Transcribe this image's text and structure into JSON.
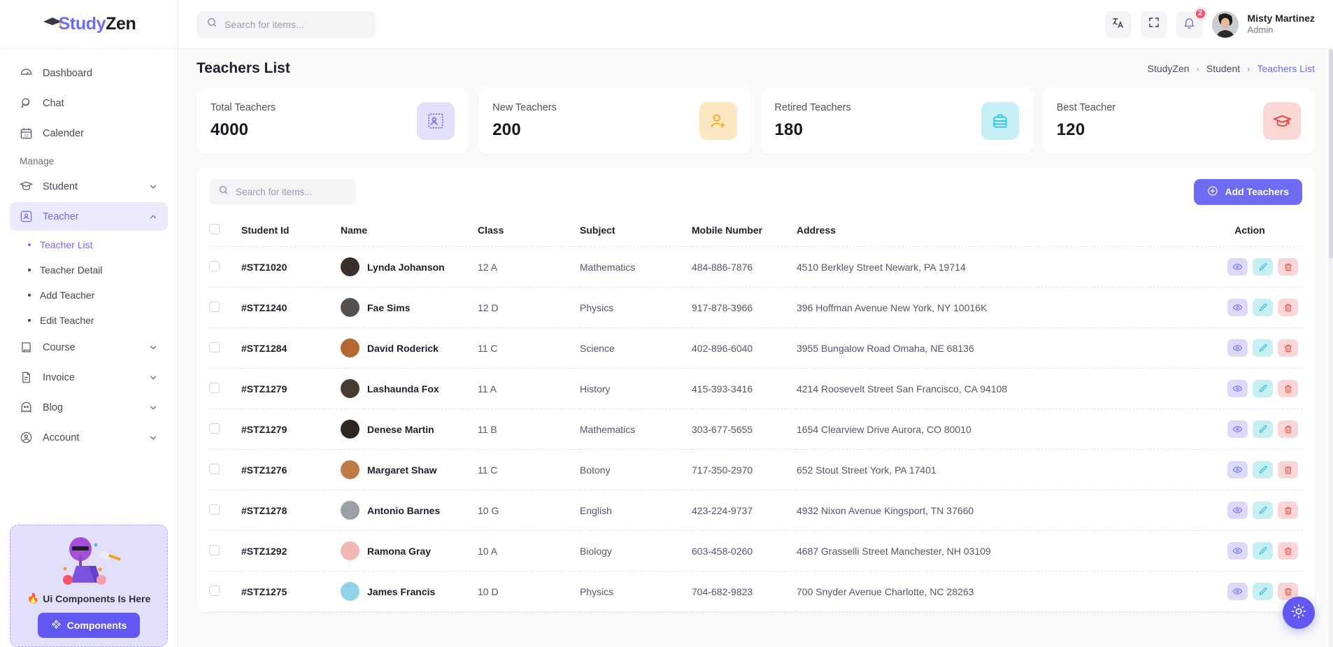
{
  "brand": {
    "part1": "Study",
    "part2": "Zen"
  },
  "sidebar": {
    "primary": [
      {
        "label": "Dashboard",
        "icon": "dashboard-icon"
      },
      {
        "label": "Chat",
        "icon": "chat-icon"
      },
      {
        "label": "Calender",
        "icon": "calendar-icon"
      }
    ],
    "group_label": "Manage",
    "manage": [
      {
        "label": "Student",
        "icon": "student-cap-icon",
        "expanded": false
      },
      {
        "label": "Teacher",
        "icon": "teacher-frame-icon",
        "expanded": true
      }
    ],
    "teacher_children": [
      {
        "label": "Teacher List",
        "active": true
      },
      {
        "label": "Teacher Detail",
        "active": false
      },
      {
        "label": "Add Teacher",
        "active": false
      },
      {
        "label": "Edit Teacher",
        "active": false
      }
    ],
    "manage_rest": [
      {
        "label": "Course",
        "icon": "book-icon"
      },
      {
        "label": "Invoice",
        "icon": "file-text-icon"
      },
      {
        "label": "Blog",
        "icon": "ghost-icon"
      },
      {
        "label": "Account",
        "icon": "user-circle-icon"
      }
    ],
    "promo": {
      "title": "Ui Components Is Here",
      "fire": "🔥",
      "button": "Components"
    }
  },
  "topbar": {
    "search_placeholder": "Search for items...",
    "notification_count": "2",
    "user": {
      "name": "Misty Martinez",
      "role": "Admin"
    }
  },
  "page": {
    "title": "Teachers List",
    "breadcrumb": [
      {
        "label": "StudyZen",
        "current": false
      },
      {
        "label": "Student",
        "current": false
      },
      {
        "label": "Teachers List",
        "current": true
      }
    ]
  },
  "stats": [
    {
      "label": "Total Teachers",
      "value": "4000",
      "icon": "portrait-frame-icon",
      "bg": "#e2dffb",
      "fg": "#6f6bf2"
    },
    {
      "label": "New Teachers",
      "value": "200",
      "icon": "user-plus-icon",
      "bg": "#fce7c3",
      "fg": "#f5a623"
    },
    {
      "label": "Retired Teachers",
      "value": "180",
      "icon": "briefcase-icon",
      "bg": "#c6eff7",
      "fg": "#1ec8e8"
    },
    {
      "label": "Best Teacher",
      "value": "120",
      "icon": "graduation-cap-icon",
      "bg": "#fbd8d6",
      "fg": "#f04438"
    }
  ],
  "toolbar": {
    "search_placeholder": "Search for items...",
    "add_label": "Add Teachers"
  },
  "table": {
    "columns": [
      "Student Id",
      "Name",
      "Class",
      "Subject",
      "Mobile Number",
      "Address",
      "Action"
    ],
    "rows": [
      {
        "id": "#STZ1020",
        "name": "Lynda Johanson",
        "class": "12 A",
        "subject": "Mathematics",
        "mobile": "484-886-7876",
        "address": "4510 Berkley Street Newark, PA 19714",
        "avatar": "#3b2f2a"
      },
      {
        "id": "#STZ1240",
        "name": "Fae Sims",
        "class": "12 D",
        "subject": "Physics",
        "mobile": "917-878-3966",
        "address": "396 Hoffman Avenue New York, NY 10016K",
        "avatar": "#55504b"
      },
      {
        "id": "#STZ1284",
        "name": "David Roderick",
        "class": "11 C",
        "subject": "Science",
        "mobile": "402-896-6040",
        "address": "3955 Bungalow Road Omaha, NE 68136",
        "avatar": "#b5682f"
      },
      {
        "id": "#STZ1279",
        "name": "Lashaunda Fox",
        "class": "11 A",
        "subject": "History",
        "mobile": "415-393-3416",
        "address": "4214 Roosevelt Street San Francisco, CA 94108",
        "avatar": "#4a3b33"
      },
      {
        "id": "#STZ1279",
        "name": "Denese Martin",
        "class": "11 B",
        "subject": "Mathematics",
        "mobile": "303-677-5655",
        "address": "1654 Clearview Drive Aurora, CO 80010",
        "avatar": "#2f2622"
      },
      {
        "id": "#STZ1276",
        "name": "Margaret Shaw",
        "class": "11 C",
        "subject": "Botony",
        "mobile": "717-350-2970",
        "address": "652 Stout Street York, PA 17401",
        "avatar": "#c07a44"
      },
      {
        "id": "#STZ1278",
        "name": "Antonio Barnes",
        "class": "10 G",
        "subject": "English",
        "mobile": "423-224-9737",
        "address": "4932 Nixon Avenue Kingsport, TN 37660",
        "avatar": "#9aa0a6"
      },
      {
        "id": "#STZ1292",
        "name": "Ramona Gray",
        "class": "10 A",
        "subject": "Biology",
        "mobile": "603-458-0260",
        "address": "4687 Grasselli Street Manchester, NH 03109",
        "avatar": "#f3b8b4"
      },
      {
        "id": "#STZ1275",
        "name": "James Francis",
        "class": "10 D",
        "subject": "Physics",
        "mobile": "704-682-9823",
        "address": "700 Snyder Avenue Charlotte, NC 28263",
        "avatar": "#8fd3e8"
      }
    ],
    "action_icons": [
      "eye-icon",
      "pencil-icon",
      "trash-icon"
    ]
  },
  "fab": {
    "icon": "sun-icon"
  },
  "colors": {
    "accent": "#6f6bf2",
    "danger": "#f04438",
    "info": "#1ec8e8",
    "warning": "#f5a623"
  }
}
